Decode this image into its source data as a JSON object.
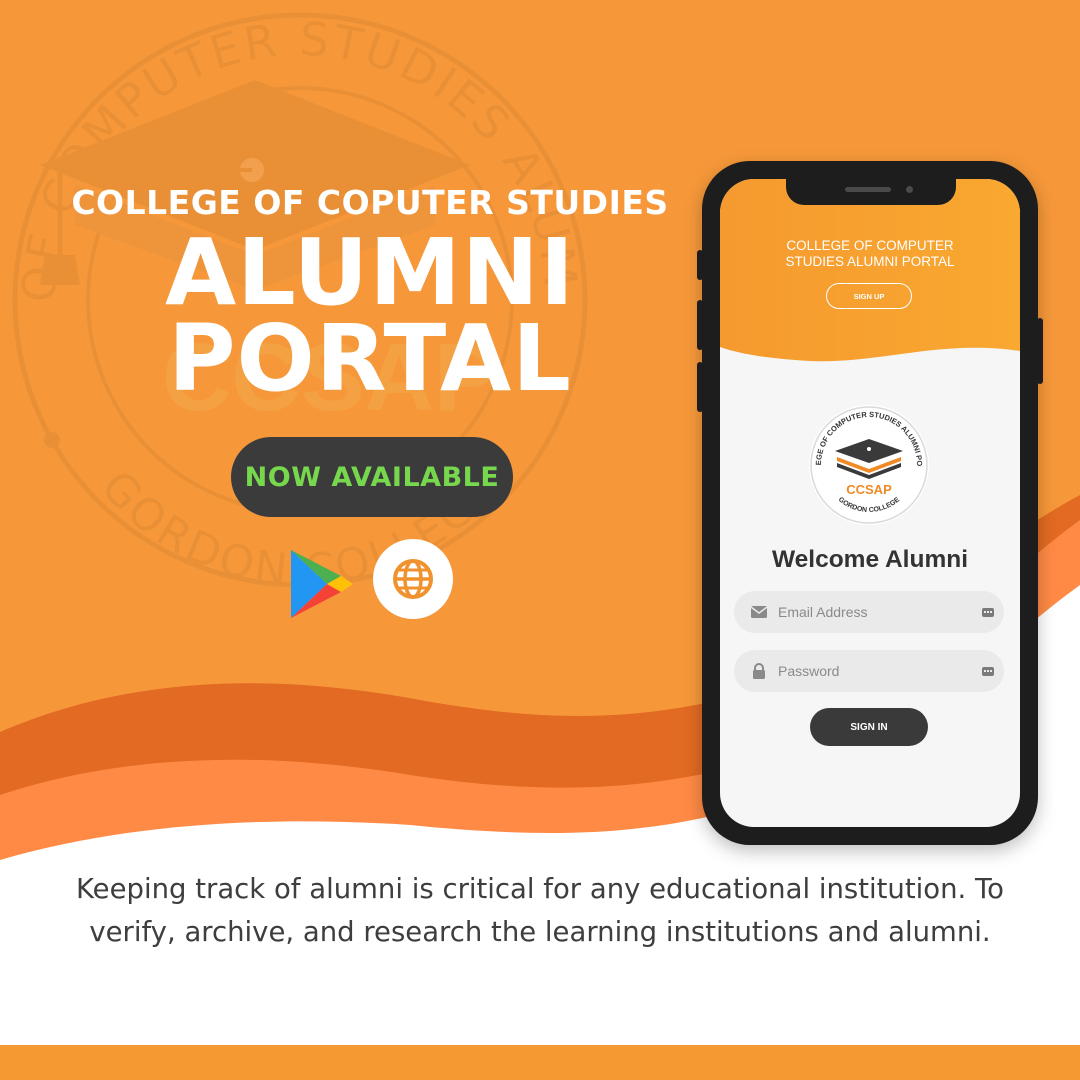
{
  "colors": {
    "background_orange": "#f6983a",
    "wave_dark_orange": "#e26a22",
    "wave_light_orange": "#ff8a45",
    "pill_dark": "#3b3b3b",
    "pill_text_green": "#77d84e",
    "app_orange_start": "#f59a2f",
    "app_orange_end": "#f9a830"
  },
  "background_seal": {
    "arc_text_top": "COLLEGE OF COMPUTER STUDIES ALUMNI PORTAL",
    "arc_text_bottom": "GORDON COLLEGE",
    "center_text": "CCSAP",
    "icon": "graduation-cap-icon"
  },
  "headline": {
    "subtitle": "COLLEGE OF COPUTER STUDIES",
    "line1": "ALUMNI",
    "line2": "PORTAL"
  },
  "cta": {
    "badge_label": "NOW AVAILABLE",
    "icons": [
      "google-play-icon",
      "globe-icon"
    ]
  },
  "app": {
    "header_title": "COLLEGE OF COMPUTER STUDIES ALUMNI PORTAL",
    "signup_label": "SIGN UP",
    "logo": {
      "arc_text_top": "COLLEGE OF COMPUTER STUDIES ALUMNI PORTAL",
      "arc_text_bottom": "GORDON COLLEGE",
      "center_text": "CCSAP"
    },
    "welcome_text": "Welcome Alumni",
    "email_placeholder": "Email Address",
    "password_placeholder": "Password",
    "signin_label": "SIGN IN"
  },
  "description": "Keeping track of alumni is critical for any educational institution. To verify, archive, and research the learning institutions and alumni."
}
